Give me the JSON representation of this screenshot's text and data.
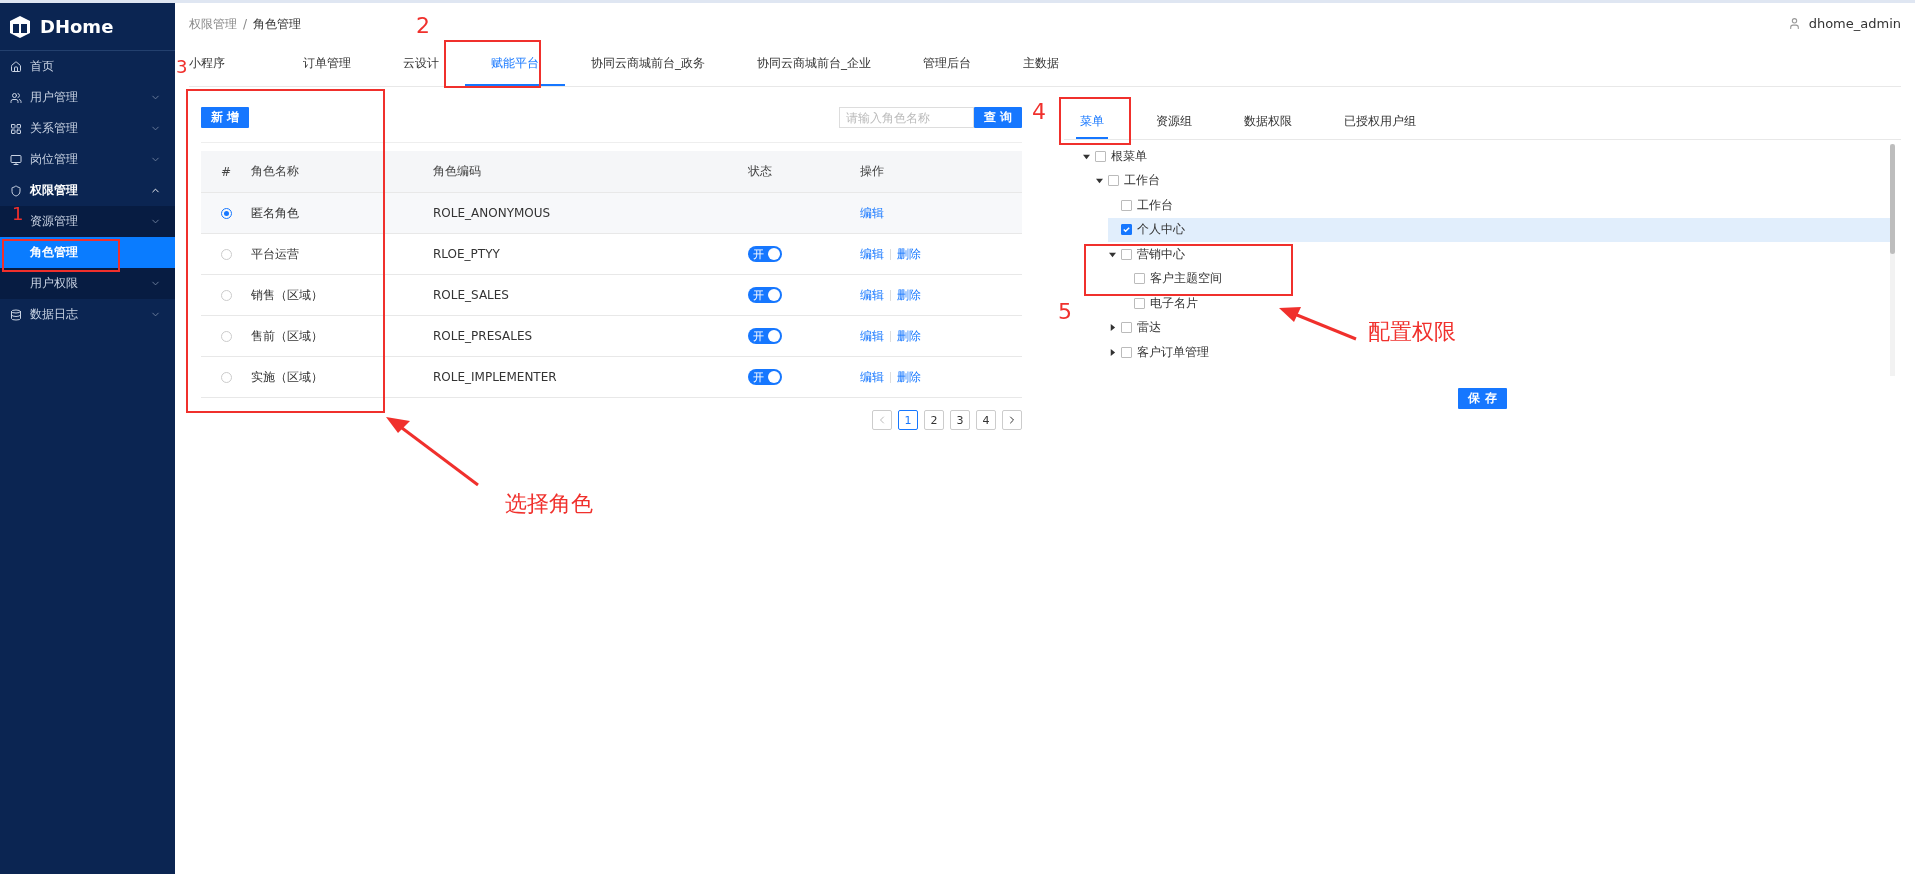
{
  "sidebar": {
    "logo": "DHome",
    "items": [
      {
        "label": "首页",
        "selected": false
      },
      {
        "label": "用户管理",
        "selected": false,
        "expanded": false
      },
      {
        "label": "关系管理",
        "selected": false,
        "expanded": false
      },
      {
        "label": "岗位管理",
        "selected": false,
        "expanded": false
      },
      {
        "label": "权限管理",
        "selected": false,
        "expanded": true,
        "children": [
          {
            "label": "资源管理",
            "selected": false,
            "expanded": false
          },
          {
            "label": "角色管理",
            "selected": true
          },
          {
            "label": "用户权限",
            "selected": false,
            "expanded": false
          }
        ]
      },
      {
        "label": "数据日志",
        "selected": false,
        "expanded": false
      }
    ]
  },
  "breadcrumb": [
    "权限管理",
    "/",
    "角色管理"
  ],
  "user": {
    "name": "dhome_admin"
  },
  "tabs": [
    {
      "label": "小程序",
      "selected": false
    },
    {
      "label": "订单管理",
      "selected": false
    },
    {
      "label": "云设计",
      "selected": false
    },
    {
      "label": "赋能平台",
      "selected": true
    },
    {
      "label": "协同云商城前台_政务",
      "selected": false
    },
    {
      "label": "协同云商城前台_企业",
      "selected": false
    },
    {
      "label": "管理后台",
      "selected": false
    },
    {
      "label": "主数据",
      "selected": false
    }
  ],
  "roles": {
    "add_button": "新 增",
    "search": {
      "placeholder": "请输入角色名称"
    },
    "search_button": "查 询",
    "columns": [
      "#",
      "角色名称",
      "角色编码",
      "状态",
      "操作"
    ],
    "rows": [
      {
        "selected": true,
        "name": "匿名角色",
        "code": "ROLE_ANONYMOUS",
        "actions": [
          "编辑"
        ]
      },
      {
        "selected": false,
        "name": "平台运营",
        "code": "RLOE_PTYY",
        "status": {
          "label": "开",
          "on": true
        },
        "actions": [
          "编辑",
          "删除"
        ]
      },
      {
        "selected": false,
        "name": "销售（区域）",
        "code": "ROLE_SALES",
        "status": {
          "label": "开",
          "on": true
        },
        "actions": [
          "编辑",
          "删除"
        ]
      },
      {
        "selected": false,
        "name": "售前（区域）",
        "code": "ROLE_PRESALES",
        "status": {
          "label": "开",
          "on": true
        },
        "actions": [
          "编辑",
          "删除"
        ]
      },
      {
        "selected": false,
        "name": "实施（区域）",
        "code": "ROLE_IMPLEMENTER",
        "status": {
          "label": "开",
          "on": true
        },
        "actions": [
          "编辑",
          "删除"
        ]
      }
    ],
    "pagination": [
      {
        "label": "1",
        "selected": true
      },
      {
        "label": "2",
        "selected": false
      },
      {
        "label": "3",
        "selected": false
      },
      {
        "label": "4",
        "selected": false
      }
    ]
  },
  "permissions": {
    "tabs": [
      {
        "label": "菜单",
        "selected": true
      },
      {
        "label": "资源组",
        "selected": false
      },
      {
        "label": "数据权限",
        "selected": false
      },
      {
        "label": "已授权用户组",
        "selected": false
      }
    ],
    "tree": [
      {
        "label": "根菜单",
        "checked": false,
        "selected": false,
        "expanded": true,
        "children": [
          {
            "label": "工作台",
            "checked": false,
            "selected": false,
            "expanded": true,
            "children": [
              {
                "label": "工作台",
                "checked": false,
                "selected": false
              },
              {
                "label": "个人中心",
                "checked": true,
                "selected": true
              },
              {
                "label": "营销中心",
                "checked": false,
                "selected": false,
                "expanded": true,
                "children": [
                  {
                    "label": "客户主题空间",
                    "checked": false,
                    "selected": false
                  },
                  {
                    "label": "电子名片",
                    "checked": false,
                    "selected": false
                  }
                ]
              },
              {
                "label": "雷达",
                "checked": false,
                "selected": false,
                "expanded": false
              },
              {
                "label": "客户订单管理",
                "checked": false,
                "selected": false,
                "expanded": false
              }
            ]
          }
        ]
      }
    ],
    "save_button": "保 存"
  },
  "annotations": {
    "numbers": [
      "1",
      "2",
      "3",
      "4",
      "5"
    ],
    "labels": [
      "选择角色",
      "配置权限"
    ]
  }
}
